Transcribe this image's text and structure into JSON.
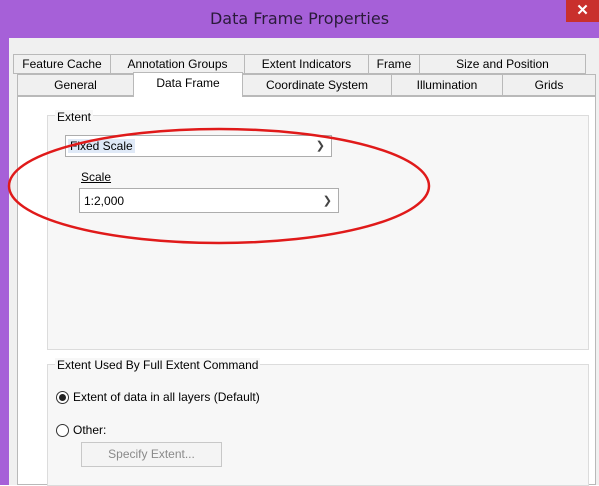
{
  "window": {
    "title": "Data Frame Properties",
    "close_label": "✕"
  },
  "tabs": {
    "row_top": [
      {
        "label": "Feature Cache"
      },
      {
        "label": "Annotation Groups"
      },
      {
        "label": "Extent Indicators"
      },
      {
        "label": "Frame"
      },
      {
        "label": "Size and Position"
      }
    ],
    "row_bottom": [
      {
        "label": "General"
      },
      {
        "label": "Data Frame",
        "active": true
      },
      {
        "label": "Coordinate System"
      },
      {
        "label": "Illumination"
      },
      {
        "label": "Grids"
      }
    ]
  },
  "extent": {
    "group_label": "Extent",
    "mode_value": "Fixed Scale",
    "scale_label": "Scale",
    "scale_value": "1:2,000"
  },
  "full_extent": {
    "group_label": "Extent Used By Full Extent Command",
    "option_default": "Extent of data in all layers (Default)",
    "option_other": "Other:",
    "selected": "default",
    "specify_button": "Specify Extent..."
  },
  "annotation": {
    "ellipse_color": "#e01a1a"
  }
}
